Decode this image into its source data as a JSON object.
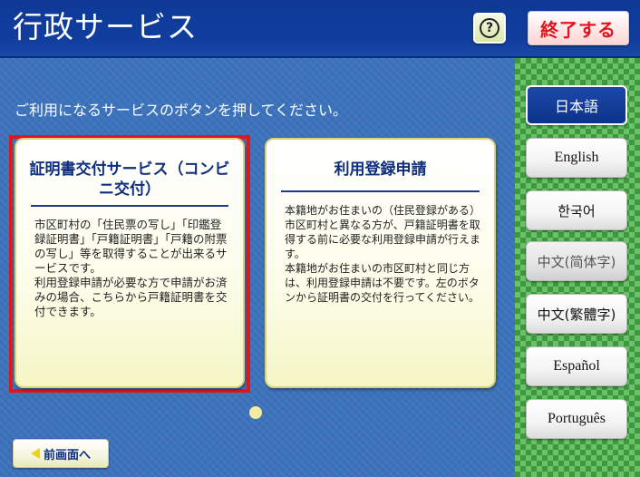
{
  "header": {
    "title": "行政サービス",
    "help_label": "?",
    "end_label": "終了する"
  },
  "main": {
    "instruction": "ご利用になるサービスのボタンを押してください。",
    "cards": [
      {
        "title": "証明書交付サービス（コンビニ交付）",
        "body": "市区町村の「住民票の写し」「印鑑登録証明書」「戸籍証明書」「戸籍の附票の写し」等を取得することが出来るサービスです。\n利用登録申請が必要な方で申請がお済みの場合、こちらから戸籍証明書を交付できます。",
        "selected": true
      },
      {
        "title": "利用登録申請",
        "body": "本籍地がお住まいの（住民登録がある）市区町村と異なる方が、戸籍証明書を取得する前に必要な利用登録申請が行えます。\n本籍地がお住まいの市区町村と同じ方は、利用登録申請は不要です。左のボタンから証明書の交付を行ってください。",
        "selected": false
      }
    ],
    "back_label": "前画面へ"
  },
  "languages": [
    {
      "label": "日本語",
      "state": "active"
    },
    {
      "label": "English",
      "state": "normal"
    },
    {
      "label": "한국어",
      "state": "normal"
    },
    {
      "label": "中文(简体字)",
      "state": "disabled"
    },
    {
      "label": "中文(繁體字)",
      "state": "normal"
    },
    {
      "label": "Español",
      "state": "normal"
    },
    {
      "label": "Português",
      "state": "normal"
    }
  ],
  "colors": {
    "header_blue": "#113e9e",
    "main_blue": "#3b72bb",
    "sidebar_green": "#3c9a3c",
    "selection_red": "#e01818",
    "end_text_red": "#e0141e"
  }
}
